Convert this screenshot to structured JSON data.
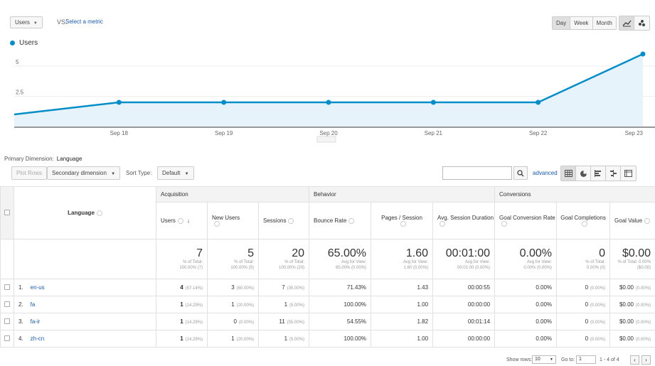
{
  "header": {
    "metric": "Users",
    "vs": "VS.",
    "select_metric": "Select a metric",
    "ranges": [
      "Day",
      "Week",
      "Month"
    ]
  },
  "legend": {
    "label": "Users",
    "color": "#058dc7"
  },
  "chart_data": {
    "type": "area",
    "series": [
      {
        "name": "Users",
        "values": [
          1,
          2,
          2,
          2,
          2,
          2,
          6
        ]
      }
    ],
    "categories": [
      "",
      "Sep 18",
      "Sep 19",
      "Sep 20",
      "Sep 21",
      "Sep 22",
      "Sep 23"
    ],
    "ytick_labels": [
      "5",
      "2.5"
    ],
    "ylim": [
      0,
      6
    ],
    "color": "#058dc7"
  },
  "primary_dimension": {
    "label": "Primary Dimension:",
    "value": "Language"
  },
  "toolbar": {
    "plot_rows": "Plot Rows",
    "secondary_dimension": "Secondary dimension",
    "sort_type_label": "Sort Type:",
    "sort_type_value": "Default",
    "advanced": "advanced"
  },
  "table": {
    "groups": {
      "acquisition": "Acquisition",
      "behavior": "Behavior",
      "conversions": "Conversions"
    },
    "columns": {
      "language": "Language",
      "users": "Users",
      "new_users": "New Users",
      "sessions": "Sessions",
      "bounce_rate": "Bounce Rate",
      "pages_session": "Pages / Session",
      "avg_duration": "Avg. Session Duration",
      "goal_conv_rate": "Goal Conversion Rate",
      "goal_completions": "Goal Completions",
      "goal_value": "Goal Value"
    },
    "totals": {
      "users": {
        "main": "7",
        "sub1": "% of Total:",
        "sub2": "100.00% (7)"
      },
      "new_users": {
        "main": "5",
        "sub1": "% of Total:",
        "sub2": "100.00% (5)"
      },
      "sessions": {
        "main": "20",
        "sub1": "% of Total:",
        "sub2": "100.00% (20)"
      },
      "bounce_rate": {
        "main": "65.00%",
        "sub1": "Avg for View:",
        "sub2": "65.00% (0.00%)"
      },
      "pages_session": {
        "main": "1.60",
        "sub1": "Avg for View:",
        "sub2": "1.60 (0.00%)"
      },
      "avg_duration": {
        "main": "00:01:00",
        "sub1": "Avg for View:",
        "sub2": "00:01:00 (0.00%)"
      },
      "goal_conv_rate": {
        "main": "0.00%",
        "sub1": "Avg for View:",
        "sub2": "0.00% (0.00%)"
      },
      "goal_completions": {
        "main": "0",
        "sub1": "% of Total:",
        "sub2": "0.00% (0)"
      },
      "goal_value": {
        "main": "$0.00",
        "sub1": "% of Total: 0.00%",
        "sub2": "($0.00)"
      }
    },
    "rows": [
      {
        "idx": "1.",
        "lang": "en-us",
        "users": "4",
        "users_pct": "(57.14%)",
        "new_users": "3",
        "new_users_pct": "(60.00%)",
        "sessions": "7",
        "sessions_pct": "(35.00%)",
        "bounce": "71.43%",
        "pps": "1.43",
        "dur": "00:00:55",
        "gcr": "0.00%",
        "gc": "0",
        "gc_pct": "(0.00%)",
        "gv": "$0.00",
        "gv_pct": "(0.00%)"
      },
      {
        "idx": "2.",
        "lang": "fa",
        "users": "1",
        "users_pct": "(14.29%)",
        "new_users": "1",
        "new_users_pct": "(20.00%)",
        "sessions": "1",
        "sessions_pct": "(5.00%)",
        "bounce": "100.00%",
        "pps": "1.00",
        "dur": "00:00:00",
        "gcr": "0.00%",
        "gc": "0",
        "gc_pct": "(0.00%)",
        "gv": "$0.00",
        "gv_pct": "(0.00%)"
      },
      {
        "idx": "3.",
        "lang": "fa-ir",
        "users": "1",
        "users_pct": "(14.29%)",
        "new_users": "0",
        "new_users_pct": "(0.00%)",
        "sessions": "11",
        "sessions_pct": "(55.00%)",
        "bounce": "54.55%",
        "pps": "1.82",
        "dur": "00:01:14",
        "gcr": "0.00%",
        "gc": "0",
        "gc_pct": "(0.00%)",
        "gv": "$0.00",
        "gv_pct": "(0.00%)"
      },
      {
        "idx": "4.",
        "lang": "zh-cn",
        "users": "1",
        "users_pct": "(14.29%)",
        "new_users": "1",
        "new_users_pct": "(20.00%)",
        "sessions": "1",
        "sessions_pct": "(5.00%)",
        "bounce": "100.00%",
        "pps": "1.00",
        "dur": "00:00:00",
        "gcr": "0.00%",
        "gc": "0",
        "gc_pct": "(0.00%)",
        "gv": "$0.00",
        "gv_pct": "(0.00%)"
      }
    ]
  },
  "pager": {
    "show_rows_label": "Show rows:",
    "show_rows_value": "10",
    "goto_label": "Go to:",
    "goto_value": "1",
    "range": "1 - 4 of 4"
  }
}
